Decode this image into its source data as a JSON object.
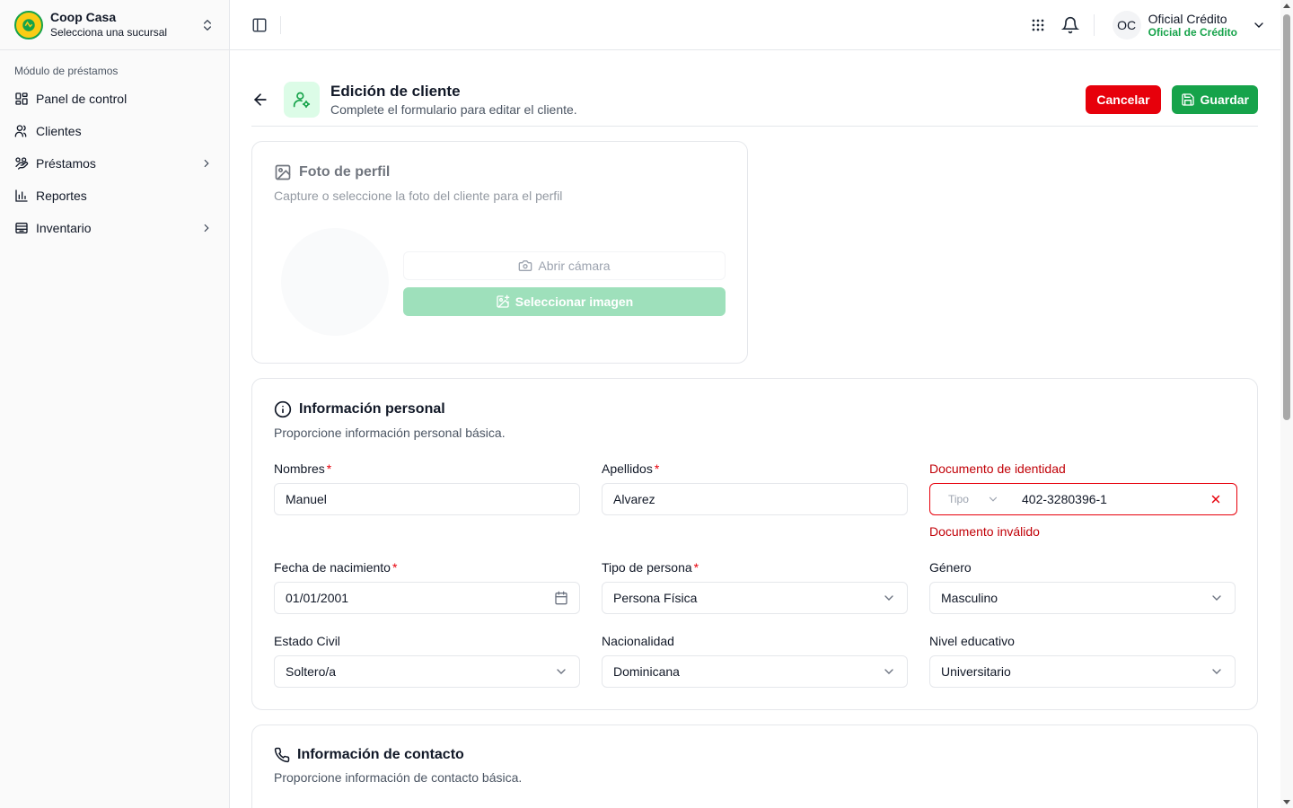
{
  "brand": {
    "title": "Coop Casa",
    "subtitle": "Selecciona una sucursal"
  },
  "sidebar": {
    "group_label": "Módulo de préstamos",
    "items": [
      {
        "label": "Panel de control",
        "icon": "dashboard-icon"
      },
      {
        "label": "Clientes",
        "icon": "users-icon"
      },
      {
        "label": "Préstamos",
        "icon": "handcoins-icon",
        "has_submenu": true
      },
      {
        "label": "Reportes",
        "icon": "bar-chart-icon"
      },
      {
        "label": "Inventario",
        "icon": "archive-icon",
        "has_submenu": true
      }
    ]
  },
  "topbar": {
    "user_initials": "OC",
    "user_name": "Oficial Crédito",
    "user_role": "Oficial de Crédito"
  },
  "header": {
    "title": "Edición de cliente",
    "subtitle": "Complete el formulario para editar el cliente.",
    "cancel_label": "Cancelar",
    "save_label": "Guardar"
  },
  "photo": {
    "title": "Foto de perfil",
    "subtitle": "Capture o seleccione la foto del cliente para el perfil",
    "camera_label": "Abrir cámara",
    "select_label": "Seleccionar imagen"
  },
  "personal": {
    "title": "Información personal",
    "subtitle": "Proporcione información personal básica.",
    "nombres": {
      "label": "Nombres",
      "value": "Manuel",
      "required": "*"
    },
    "apellidos": {
      "label": "Apellidos",
      "value": "Alvarez",
      "required": "*"
    },
    "documento": {
      "label": "Documento de identidad",
      "type_placeholder": "Tipo",
      "value": "402-3280396-1",
      "error": "Documento inválido"
    },
    "fecha": {
      "label": "Fecha de nacimiento",
      "value": "01/01/2001",
      "required": "*"
    },
    "tipo_persona": {
      "label": "Tipo de persona",
      "value": "Persona Física",
      "required": "*"
    },
    "genero": {
      "label": "Género",
      "value": "Masculino"
    },
    "estado_civil": {
      "label": "Estado Civil",
      "value": "Soltero/a"
    },
    "nacionalidad": {
      "label": "Nacionalidad",
      "value": "Dominicana"
    },
    "nivel_educativo": {
      "label": "Nivel educativo",
      "value": "Universitario"
    }
  },
  "contact": {
    "title": "Información de contacto",
    "subtitle": "Proporcione información de contacto básica."
  },
  "colors": {
    "primary_green": "#16a34a",
    "danger_red": "#e7000b",
    "brand_yellow": "#facc15"
  }
}
